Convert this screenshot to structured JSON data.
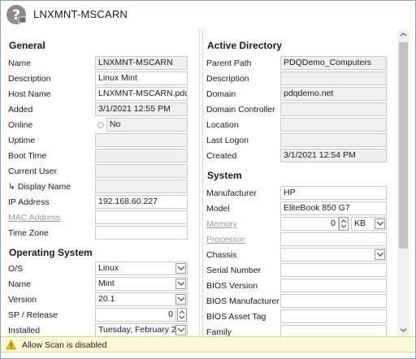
{
  "window": {
    "title": "LNXMNT-MSCARN",
    "icon": "question-computer-icon"
  },
  "general": {
    "heading": "General",
    "fields": [
      {
        "label": "Name",
        "value": "LNXMNT-MSCARN"
      },
      {
        "label": "Description",
        "value": "Linux Mint"
      },
      {
        "label": "Host Name",
        "value": "LNXMNT-MSCARN.pdq"
      },
      {
        "label": "Added",
        "value": "3/1/2021 12:55 PM"
      },
      {
        "label": "Online",
        "value": "No"
      },
      {
        "label": "Uptime",
        "value": ""
      },
      {
        "label": "Boot Time",
        "value": ""
      },
      {
        "label": "Current User",
        "value": ""
      },
      {
        "label": "↳ Display Name",
        "value": ""
      },
      {
        "label": "IP Address",
        "value": "192.168.60.227"
      },
      {
        "label": "MAC Address",
        "value": ""
      },
      {
        "label": "Time Zone",
        "value": ""
      }
    ]
  },
  "operating_system": {
    "heading": "Operating System",
    "fields": [
      {
        "label": "O/S",
        "value": "Linux"
      },
      {
        "label": "Name",
        "value": "Mint"
      },
      {
        "label": "Version",
        "value": "20.1"
      },
      {
        "label": "SP / Release",
        "value": "0"
      },
      {
        "label": "Installed",
        "value": "Tuesday, February 2"
      }
    ]
  },
  "active_directory": {
    "heading": "Active Directory",
    "fields": [
      {
        "label": "Parent Path",
        "value": "PDQDemo_Computers"
      },
      {
        "label": "Description",
        "value": ""
      },
      {
        "label": "Domain",
        "value": "pdqdemo.net"
      },
      {
        "label": "Domain Controller",
        "value": ""
      },
      {
        "label": "Location",
        "value": ""
      },
      {
        "label": "Last Logon",
        "value": ""
      },
      {
        "label": "Created",
        "value": "3/1/2021 12:54 PM"
      }
    ]
  },
  "system": {
    "heading": "System",
    "fields": [
      {
        "label": "Manufacturer",
        "value": "HP"
      },
      {
        "label": "Model",
        "value": "EliteBook 850 G7"
      },
      {
        "label": "Memory",
        "value": "0",
        "unit": "KB"
      },
      {
        "label": "Processor",
        "value": ""
      },
      {
        "label": "Chassis",
        "value": ""
      },
      {
        "label": "Serial Number",
        "value": ""
      },
      {
        "label": "BIOS Version",
        "value": ""
      },
      {
        "label": "BIOS Manufacturer",
        "value": ""
      },
      {
        "label": "BIOS Asset Tag",
        "value": ""
      },
      {
        "label": "Family",
        "value": ""
      }
    ]
  },
  "status": {
    "message": "Allow Scan is disabled",
    "icon": "warning-icon"
  },
  "colors": {
    "status_bg": "#fcf9d6",
    "readonly_bg": "#f0f0f0",
    "disabled_label": "#9a9a9a"
  }
}
